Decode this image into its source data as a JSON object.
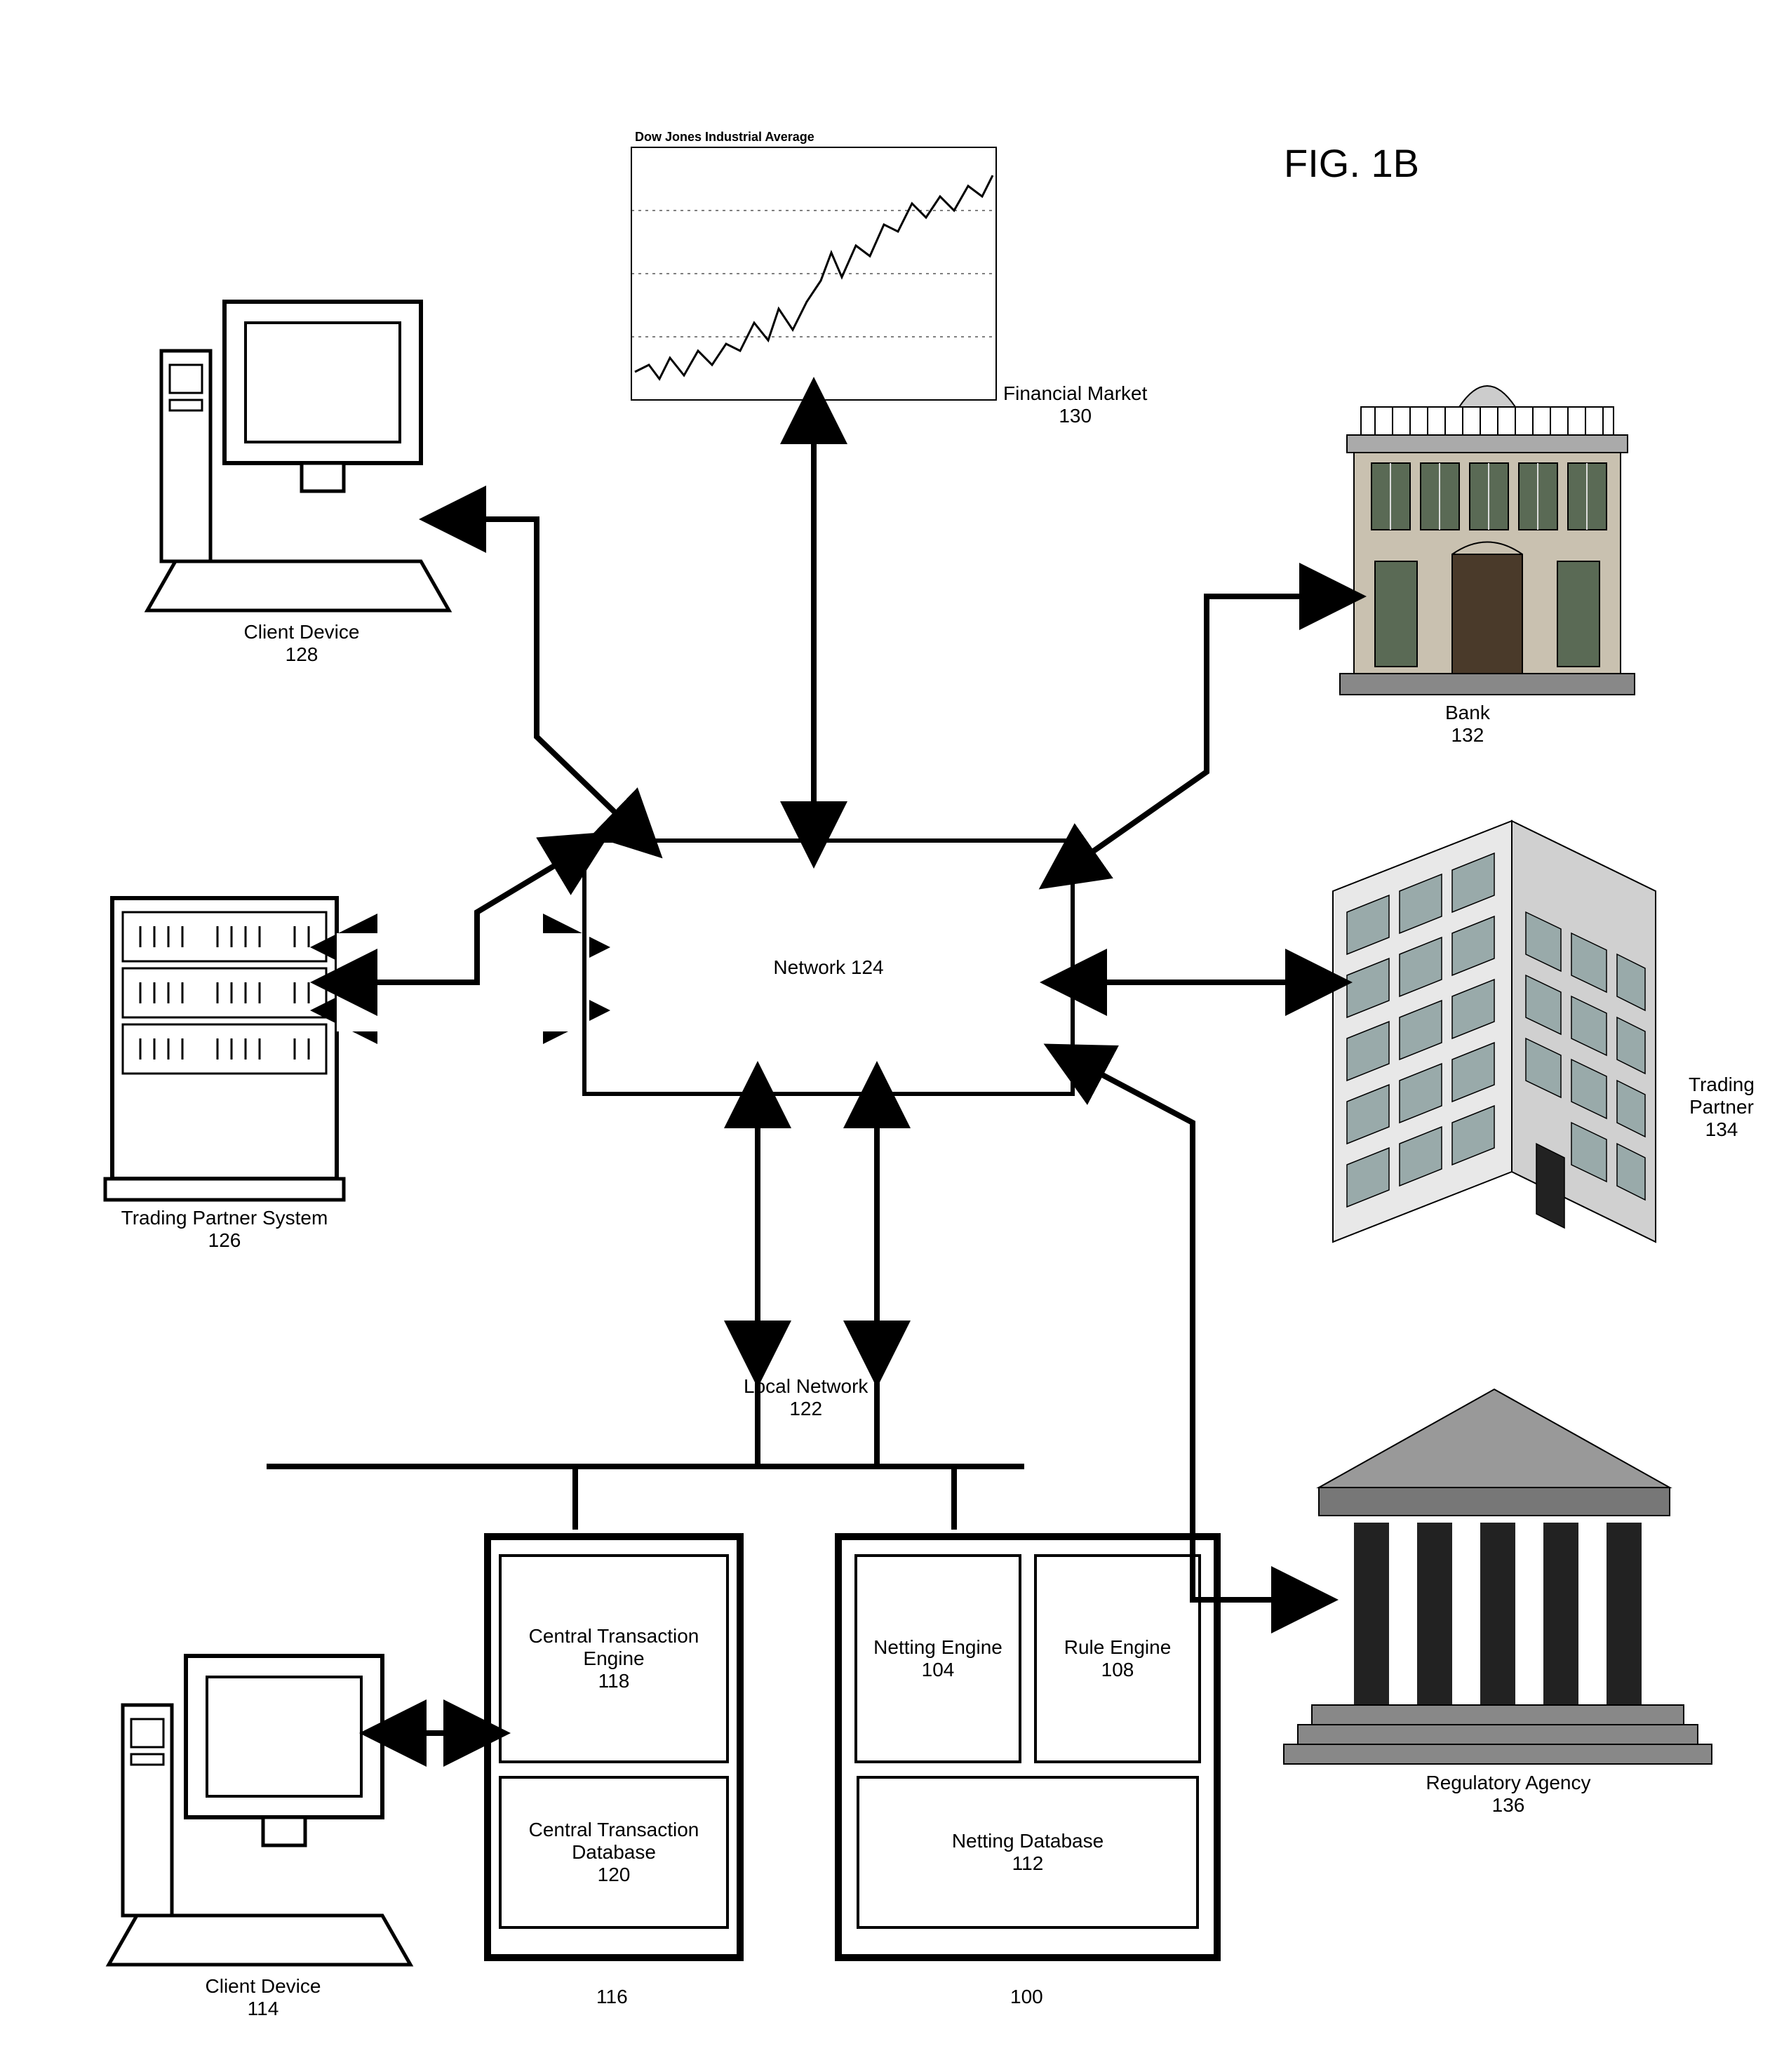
{
  "figure_title": "FIG. 1B",
  "network": {
    "label": "Network 124"
  },
  "financial_market": {
    "label": "Financial Market",
    "ref": "130",
    "chart_caption": "Dow Jones Industrial Average"
  },
  "client_device_top": {
    "label": "Client Device",
    "ref": "128"
  },
  "trading_partner_system": {
    "label": "Trading Partner System",
    "ref": "126"
  },
  "client_device_bottom": {
    "label": "Client Device",
    "ref": "114"
  },
  "local_network": {
    "label": "Local Network",
    "ref": "122"
  },
  "central_server": {
    "ref": "116",
    "engine": {
      "label": "Central Transaction Engine",
      "ref": "118"
    },
    "db": {
      "label": "Central Transaction Database",
      "ref": "120"
    }
  },
  "netting_server": {
    "ref": "100",
    "engine": {
      "label": "Netting Engine",
      "ref": "104"
    },
    "rule": {
      "label": "Rule Engine",
      "ref": "108"
    },
    "db": {
      "label": "Netting Database",
      "ref": "112"
    }
  },
  "bank": {
    "label": "Bank",
    "ref": "132"
  },
  "trading_partner": {
    "label": "Trading Partner",
    "ref": "134"
  },
  "regulatory_agency": {
    "label": "Regulatory Agency",
    "ref": "136"
  }
}
